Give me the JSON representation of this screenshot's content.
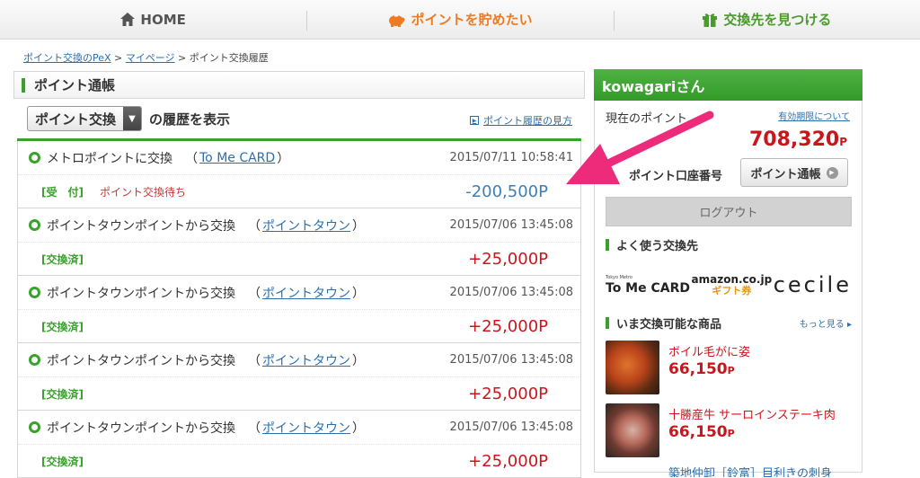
{
  "nav": {
    "home": "HOME",
    "save": "ポイントを貯めたい",
    "find": "交換先を見つける"
  },
  "breadcrumb": {
    "item1": "ポイント交換のPeX",
    "item2": "マイページ",
    "sep": ">",
    "current": "ポイント交換履歴"
  },
  "left": {
    "heading": "ポイント通帳",
    "filter_value": "ポイント交換",
    "filter_suffix": "の履歴を表示",
    "guide_link": "ポイント履歴の見方"
  },
  "history": [
    {
      "title": "メトロポイントに交換",
      "partner": "To Me CARD",
      "date": "2015/07/11 10:58:41",
      "status": "[受　付]",
      "note": "ポイント交換待ち",
      "amount": "-200,500P"
    },
    {
      "title": "ポイントタウンポイントから交換",
      "partner": "ポイントタウン",
      "date": "2015/07/06 13:45:08",
      "status": "[交換済]",
      "note": "",
      "amount": "+25,000P"
    },
    {
      "title": "ポイントタウンポイントから交換",
      "partner": "ポイントタウン",
      "date": "2015/07/06 13:45:08",
      "status": "[交換済]",
      "note": "",
      "amount": "+25,000P"
    },
    {
      "title": "ポイントタウンポイントから交換",
      "partner": "ポイントタウン",
      "date": "2015/07/06 13:45:08",
      "status": "[交換済]",
      "note": "",
      "amount": "+25,000P"
    },
    {
      "title": "ポイントタウンポイントから交換",
      "partner": "ポイントタウン",
      "date": "2015/07/06 13:45:08",
      "status": "[交換済]",
      "note": "",
      "amount": "+25,000P"
    }
  ],
  "paren_open": "（",
  "paren_close": "）",
  "sidebar": {
    "user": "kowagariさん",
    "points_label": "現在のポイント",
    "expiry_link": "有効期限について",
    "points_value": "708,320",
    "points_unit": "P",
    "account_label": "ポイント口座番号",
    "passbook_button": "ポイント通帳",
    "logout": "ログアウト",
    "favorites_heading": "よく使う交換先",
    "logo_tome_small": "Tokyo Metro",
    "logo_tome": "To Me CARD",
    "logo_amazon": "amazon.co.jp",
    "logo_amazon_gift": "ギフト券",
    "logo_cecile": "cecile",
    "products_heading": "いま交換可能な商品",
    "more_link": "もっと見る",
    "products": [
      {
        "name": "ボイル毛がに姿",
        "price": "66,150",
        "unit": "P"
      },
      {
        "name": "十勝産牛 サーロインステーキ肉",
        "price": "66,150",
        "unit": "P"
      }
    ],
    "cut_product": "築地仲卸［鈴富］目利きの刺身"
  },
  "colors": {
    "accent_green": "#3aa12d",
    "points_red": "#c9161d",
    "link_blue": "#2a6fb0",
    "annotation_pink": "#ee2a7b"
  }
}
